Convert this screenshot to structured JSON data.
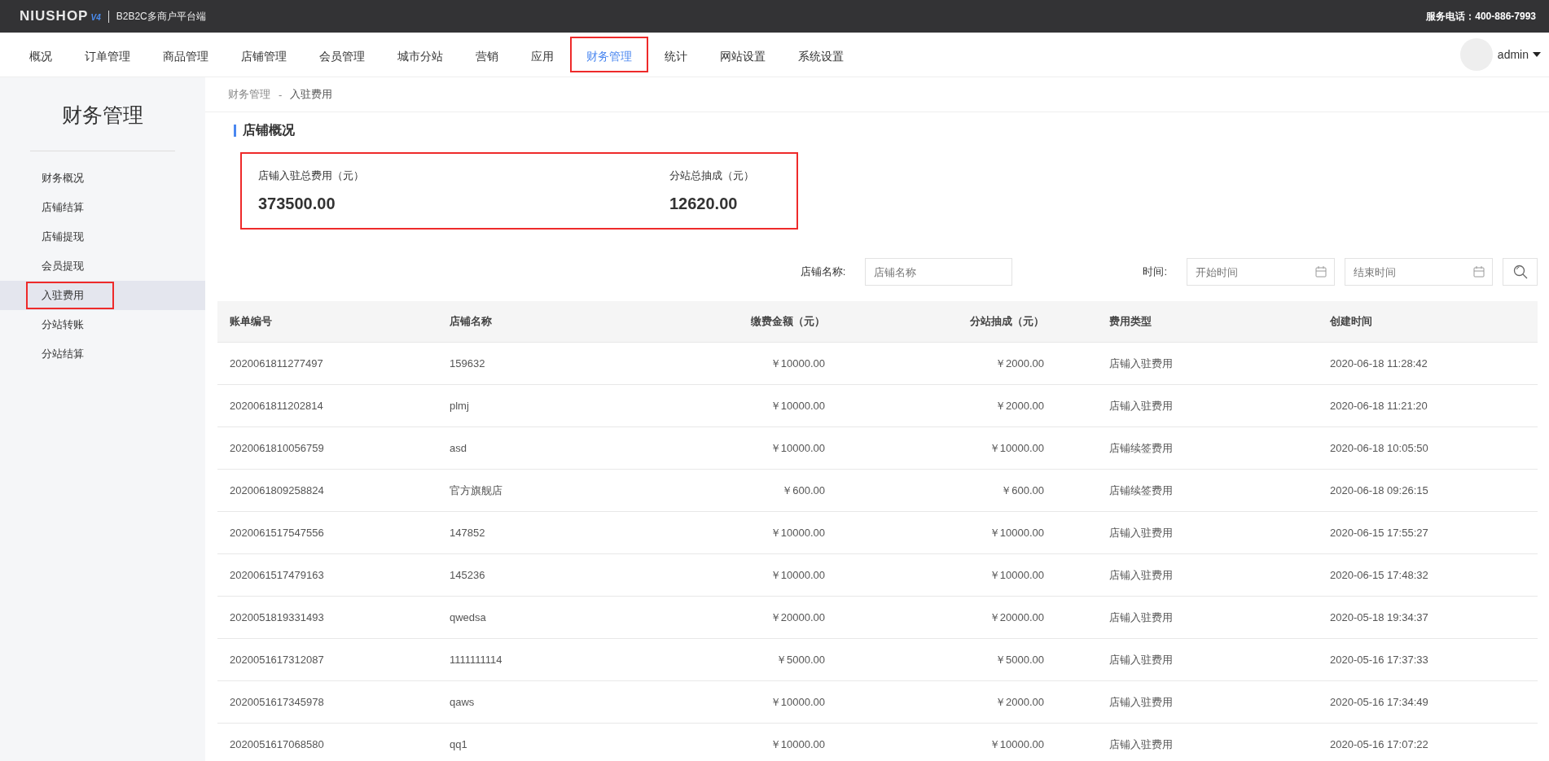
{
  "header": {
    "logo": "NIUSHOP",
    "logo_version": "V4",
    "platform": "B2B2C多商户平台端",
    "service_phone": "服务电话：400-886-7993"
  },
  "nav": {
    "items": [
      {
        "label": "概况",
        "selected": false,
        "annotated": false
      },
      {
        "label": "订单管理",
        "selected": false,
        "annotated": false
      },
      {
        "label": "商品管理",
        "selected": false,
        "annotated": false
      },
      {
        "label": "店铺管理",
        "selected": false,
        "annotated": false
      },
      {
        "label": "会员管理",
        "selected": false,
        "annotated": false
      },
      {
        "label": "城市分站",
        "selected": false,
        "annotated": false
      },
      {
        "label": "营销",
        "selected": false,
        "annotated": false
      },
      {
        "label": "应用",
        "selected": false,
        "annotated": false
      },
      {
        "label": "财务管理",
        "selected": true,
        "annotated": true
      },
      {
        "label": "统计",
        "selected": false,
        "annotated": false
      },
      {
        "label": "网站设置",
        "selected": false,
        "annotated": false
      },
      {
        "label": "系统设置",
        "selected": false,
        "annotated": false
      }
    ],
    "user": "admin"
  },
  "sidebar": {
    "title": "财务管理",
    "items": [
      {
        "label": "财务概况",
        "selected": false,
        "annotated": false
      },
      {
        "label": "店铺结算",
        "selected": false,
        "annotated": false
      },
      {
        "label": "店铺提现",
        "selected": false,
        "annotated": false
      },
      {
        "label": "会员提现",
        "selected": false,
        "annotated": false
      },
      {
        "label": "入驻费用",
        "selected": true,
        "annotated": true
      },
      {
        "label": "分站转账",
        "selected": false,
        "annotated": false
      },
      {
        "label": "分站结算",
        "selected": false,
        "annotated": false
      }
    ]
  },
  "breadcrumb": [
    "财务管理",
    "-",
    "入驻费用"
  ],
  "section_title": "店铺概况",
  "summary": {
    "annotated": true,
    "stats": [
      {
        "label": "店铺入驻总费用（元）",
        "value": "373500.00"
      },
      {
        "label": "分站总抽成（元）",
        "value": "12620.00"
      }
    ]
  },
  "filters": {
    "store_label": "店铺名称:",
    "store_placeholder": "店铺名称",
    "time_label": "时间:",
    "start_placeholder": "开始时间",
    "end_placeholder": "结束时间"
  },
  "table": {
    "columns": [
      "账单编号",
      "店铺名称",
      "缴费金额（元）",
      "分站抽成（元）",
      "费用类型",
      "创建时间"
    ],
    "rows": [
      [
        "2020061811277497",
        "159632",
        "￥10000.00",
        "￥2000.00",
        "店铺入驻费用",
        "2020-06-18 11:28:42"
      ],
      [
        "2020061811202814",
        "plmj",
        "￥10000.00",
        "￥2000.00",
        "店铺入驻费用",
        "2020-06-18 11:21:20"
      ],
      [
        "2020061810056759",
        "asd",
        "￥10000.00",
        "￥10000.00",
        "店铺续签费用",
        "2020-06-18 10:05:50"
      ],
      [
        "2020061809258824",
        "官方旗舰店",
        "￥600.00",
        "￥600.00",
        "店铺续签费用",
        "2020-06-18 09:26:15"
      ],
      [
        "2020061517547556",
        "147852",
        "￥10000.00",
        "￥10000.00",
        "店铺入驻费用",
        "2020-06-15 17:55:27"
      ],
      [
        "2020061517479163",
        "145236",
        "￥10000.00",
        "￥10000.00",
        "店铺入驻费用",
        "2020-06-15 17:48:32"
      ],
      [
        "2020051819331493",
        "qwedsa",
        "￥20000.00",
        "￥20000.00",
        "店铺入驻费用",
        "2020-05-18 19:34:37"
      ],
      [
        "2020051617312087",
        "1111111114",
        "￥5000.00",
        "￥5000.00",
        "店铺入驻费用",
        "2020-05-16 17:37:33"
      ],
      [
        "2020051617345978",
        "qaws",
        "￥10000.00",
        "￥2000.00",
        "店铺入驻费用",
        "2020-05-16 17:34:49"
      ],
      [
        "2020051617068580",
        "qq1",
        "￥10000.00",
        "￥10000.00",
        "店铺入驻费用",
        "2020-05-16 17:07:22"
      ]
    ]
  }
}
